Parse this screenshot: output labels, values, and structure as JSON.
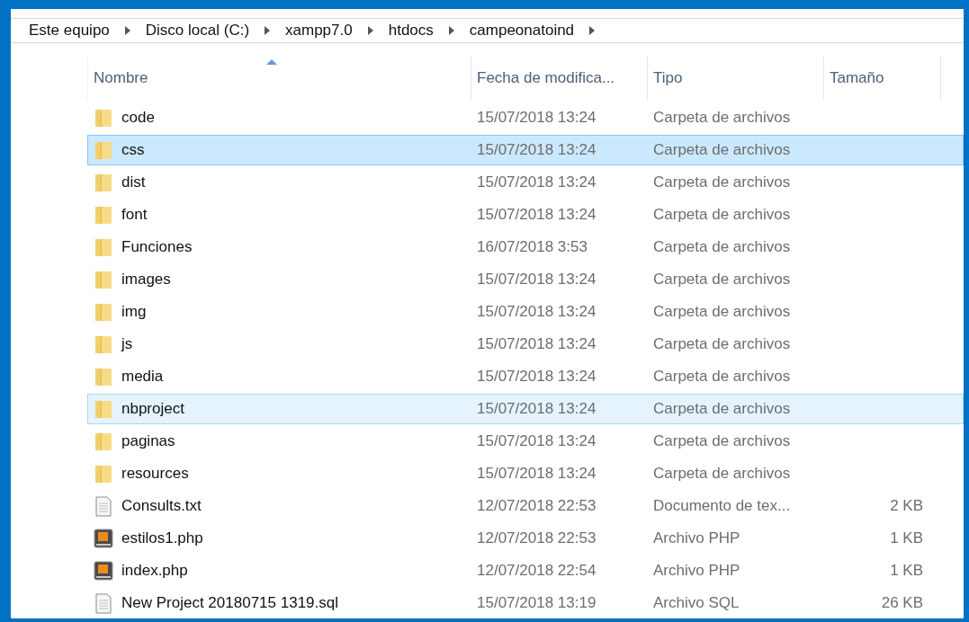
{
  "breadcrumb": [
    "Este equipo",
    "Disco local (C:)",
    "xampp7.0",
    "htdocs",
    "campeonatoind"
  ],
  "columns": [
    "Nombre",
    "Fecha de modifica...",
    "Tipo",
    "Tamaño"
  ],
  "rows": [
    {
      "kind": "folder",
      "name": "code",
      "date": "15/07/2018 13:24",
      "type": "Carpeta de archivos",
      "selected": false,
      "hover": false
    },
    {
      "kind": "folder",
      "name": "css",
      "date": "15/07/2018 13:24",
      "type": "Carpeta de archivos",
      "selected": true,
      "hover": false
    },
    {
      "kind": "folder",
      "name": "dist",
      "date": "15/07/2018 13:24",
      "type": "Carpeta de archivos",
      "selected": false,
      "hover": false
    },
    {
      "kind": "folder",
      "name": "font",
      "date": "15/07/2018 13:24",
      "type": "Carpeta de archivos",
      "selected": false,
      "hover": false
    },
    {
      "kind": "folder",
      "name": "Funciones",
      "date": "16/07/2018 3:53",
      "type": "Carpeta de archivos",
      "selected": false,
      "hover": false
    },
    {
      "kind": "folder",
      "name": "images",
      "date": "15/07/2018 13:24",
      "type": "Carpeta de archivos",
      "selected": false,
      "hover": false
    },
    {
      "kind": "folder",
      "name": "img",
      "date": "15/07/2018 13:24",
      "type": "Carpeta de archivos",
      "selected": false,
      "hover": false
    },
    {
      "kind": "folder",
      "name": "js",
      "date": "15/07/2018 13:24",
      "type": "Carpeta de archivos",
      "selected": false,
      "hover": false
    },
    {
      "kind": "folder",
      "name": "media",
      "date": "15/07/2018 13:24",
      "type": "Carpeta de archivos",
      "selected": false,
      "hover": false
    },
    {
      "kind": "folder",
      "name": "nbproject",
      "date": "15/07/2018 13:24",
      "type": "Carpeta de archivos",
      "selected": false,
      "hover": true
    },
    {
      "kind": "folder",
      "name": "paginas",
      "date": "15/07/2018 13:24",
      "type": "Carpeta de archivos",
      "selected": false,
      "hover": false
    },
    {
      "kind": "folder",
      "name": "resources",
      "date": "15/07/2018 13:24",
      "type": "Carpeta de archivos",
      "selected": false,
      "hover": false
    },
    {
      "kind": "text",
      "name": "Consults.txt",
      "date": "12/07/2018 22:53",
      "type": "Documento de tex...",
      "size": "2 KB",
      "selected": false,
      "hover": false
    },
    {
      "kind": "php",
      "name": "estilos1.php",
      "date": "12/07/2018 22:53",
      "type": "Archivo PHP",
      "size": "1 KB",
      "selected": false,
      "hover": false
    },
    {
      "kind": "php",
      "name": "index.php",
      "date": "12/07/2018 22:54",
      "type": "Archivo PHP",
      "size": "1 KB",
      "selected": false,
      "hover": false
    },
    {
      "kind": "text",
      "name": "New Project 20180715 1319.sql",
      "date": "15/07/2018 13:19",
      "type": "Archivo SQL",
      "size": "26 KB",
      "selected": false,
      "hover": false
    }
  ]
}
